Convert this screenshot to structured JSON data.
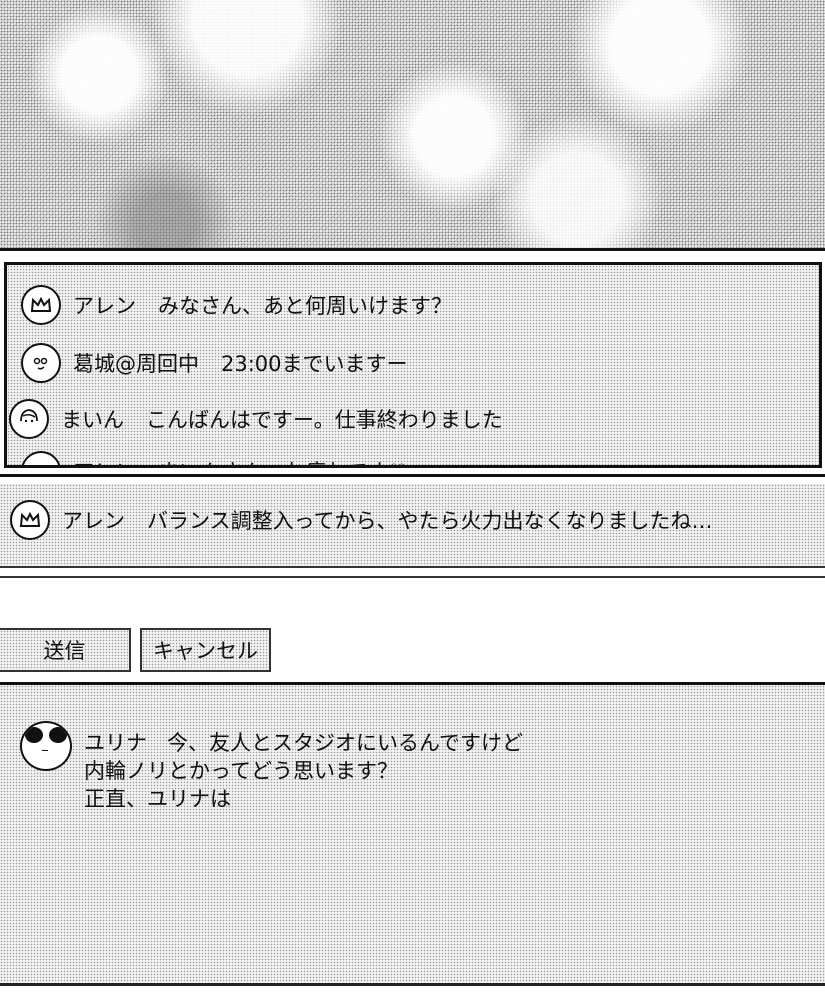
{
  "chat_log": {
    "messages": [
      {
        "avatar_icon": "crown-icon",
        "name": "アレン",
        "text": "みなさん、あと何周いけます？"
      },
      {
        "avatar_icon": "face-icon",
        "name": "葛城@周回中",
        "text": "23:00までいますー"
      },
      {
        "avatar_icon": "girl-face-icon",
        "name": "まいん",
        "text": "こんばんはですー。仕事終わりました"
      },
      {
        "avatar_icon": "round-face-icon",
        "name": "アレン",
        "text": "まいんさん、お疲れです♡"
      }
    ]
  },
  "composer": {
    "avatar_icon": "crown-icon",
    "name": "アレン",
    "text": "バランス調整入ってから、やたら火力出なくなりましたね…"
  },
  "buttons": {
    "send": "送信",
    "cancel": "キャンセル"
  },
  "preview": {
    "avatar_icon": "panda-face-icon",
    "name": "ユリナ",
    "line1": "今、友人とスタジオにいるんですけど",
    "line2": "内輪ノリとかってどう思います？",
    "line3": "正直、ユリナは"
  }
}
